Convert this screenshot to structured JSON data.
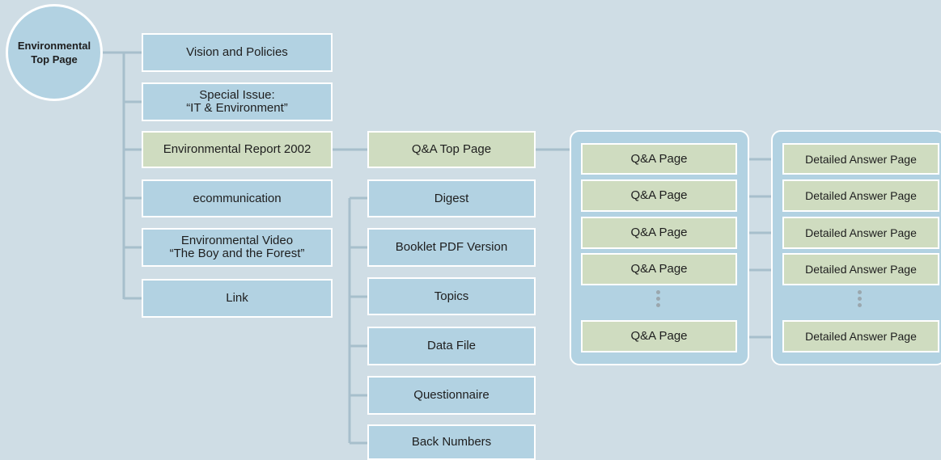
{
  "root": {
    "label": "Environmental\nTop Page"
  },
  "level1": [
    {
      "label": "Vision and Policies"
    },
    {
      "label": "Special Issue:\n“IT & Environment”"
    },
    {
      "label": "Environmental Report 2002"
    },
    {
      "label": "ecommunication"
    },
    {
      "label": "Environmental Video\n“The Boy and the Forest”"
    },
    {
      "label": "Link"
    }
  ],
  "report_children": [
    {
      "label": "Q&A Top Page"
    },
    {
      "label": "Digest"
    },
    {
      "label": "Booklet PDF Version"
    },
    {
      "label": "Topics"
    },
    {
      "label": "Data File"
    },
    {
      "label": "Questionnaire"
    },
    {
      "label": "Back Numbers"
    }
  ],
  "qa_pages": [
    "Q&A Page",
    "Q&A Page",
    "Q&A Page",
    "Q&A Page",
    "Q&A Page"
  ],
  "answer_pages": [
    "Detailed Answer Page",
    "Detailed Answer Page",
    "Detailed Answer Page",
    "Detailed Answer Page",
    "Detailed Answer Page"
  ],
  "colors": {
    "background": "#cfdde5",
    "blue_box": "#b2d2e2",
    "green_box": "#cfdcc0",
    "connector": "#a7bfcc",
    "border": "#ffffff"
  }
}
